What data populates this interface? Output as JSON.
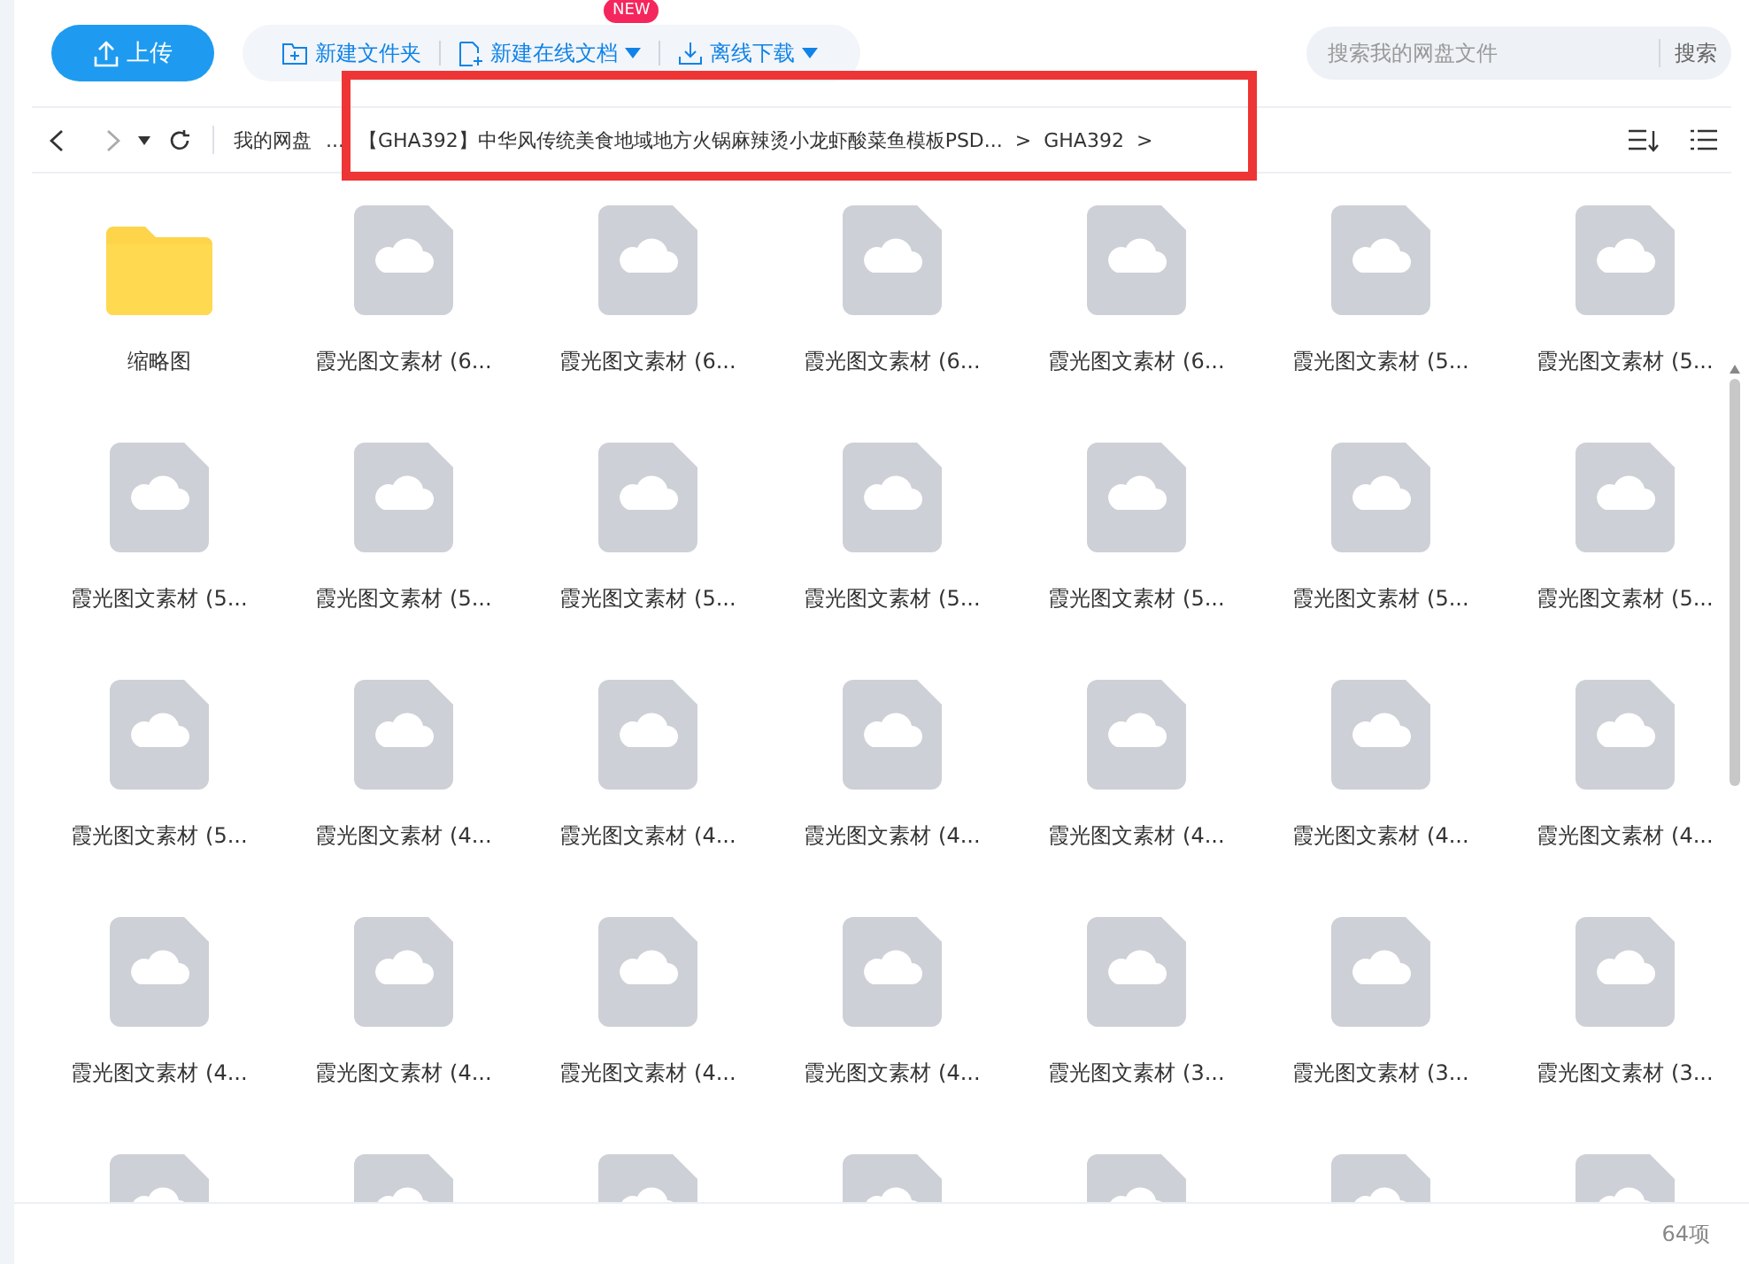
{
  "toolbar": {
    "upload": "上传",
    "actions": [
      {
        "kind": "new-folder",
        "label": "新建文件夹",
        "dropdown": false
      },
      {
        "kind": "new-doc",
        "label": "新建在线文档",
        "dropdown": true,
        "badge": "NEW"
      },
      {
        "kind": "download",
        "label": "离线下载",
        "dropdown": true
      }
    ],
    "search": {
      "placeholder": "搜索我的网盘文件",
      "button": "搜索"
    }
  },
  "breadcrumb": [
    {
      "kind": "item",
      "text": "我的网盘"
    },
    {
      "kind": "item",
      "text": "..."
    },
    {
      "kind": "item",
      "text": "【GHA392】中华风传统美食地域地方火锅麻辣烫小龙虾酸菜鱼模板PSD..."
    },
    {
      "kind": "sep",
      "text": ">"
    },
    {
      "kind": "item",
      "text": "GHA392"
    },
    {
      "kind": "sep",
      "text": ">"
    }
  ],
  "files": [
    {
      "kind": "folder",
      "name": "缩略图"
    },
    {
      "kind": "file",
      "name": "霞光图文素材 (6..."
    },
    {
      "kind": "file",
      "name": "霞光图文素材 (6..."
    },
    {
      "kind": "file",
      "name": "霞光图文素材 (6..."
    },
    {
      "kind": "file",
      "name": "霞光图文素材 (6..."
    },
    {
      "kind": "file",
      "name": "霞光图文素材 (5..."
    },
    {
      "kind": "file",
      "name": "霞光图文素材 (5..."
    },
    {
      "kind": "file",
      "name": "霞光图文素材 (5..."
    },
    {
      "kind": "file",
      "name": "霞光图文素材 (5..."
    },
    {
      "kind": "file",
      "name": "霞光图文素材 (5..."
    },
    {
      "kind": "file",
      "name": "霞光图文素材 (5..."
    },
    {
      "kind": "file",
      "name": "霞光图文素材 (5..."
    },
    {
      "kind": "file",
      "name": "霞光图文素材 (5..."
    },
    {
      "kind": "file",
      "name": "霞光图文素材 (5..."
    },
    {
      "kind": "file",
      "name": "霞光图文素材 (5..."
    },
    {
      "kind": "file",
      "name": "霞光图文素材 (4..."
    },
    {
      "kind": "file",
      "name": "霞光图文素材 (4..."
    },
    {
      "kind": "file",
      "name": "霞光图文素材 (4..."
    },
    {
      "kind": "file",
      "name": "霞光图文素材 (4..."
    },
    {
      "kind": "file",
      "name": "霞光图文素材 (4..."
    },
    {
      "kind": "file",
      "name": "霞光图文素材 (4..."
    },
    {
      "kind": "file",
      "name": "霞光图文素材 (4..."
    },
    {
      "kind": "file",
      "name": "霞光图文素材 (4..."
    },
    {
      "kind": "file",
      "name": "霞光图文素材 (4..."
    },
    {
      "kind": "file",
      "name": "霞光图文素材 (4..."
    },
    {
      "kind": "file",
      "name": "霞光图文素材 (3..."
    },
    {
      "kind": "file",
      "name": "霞光图文素材 (3..."
    },
    {
      "kind": "file",
      "name": "霞光图文素材 (3..."
    },
    {
      "kind": "file"
    },
    {
      "kind": "file"
    },
    {
      "kind": "file"
    },
    {
      "kind": "file"
    },
    {
      "kind": "file"
    },
    {
      "kind": "file"
    },
    {
      "kind": "file"
    }
  ],
  "status_bar": {
    "count": "64项"
  }
}
